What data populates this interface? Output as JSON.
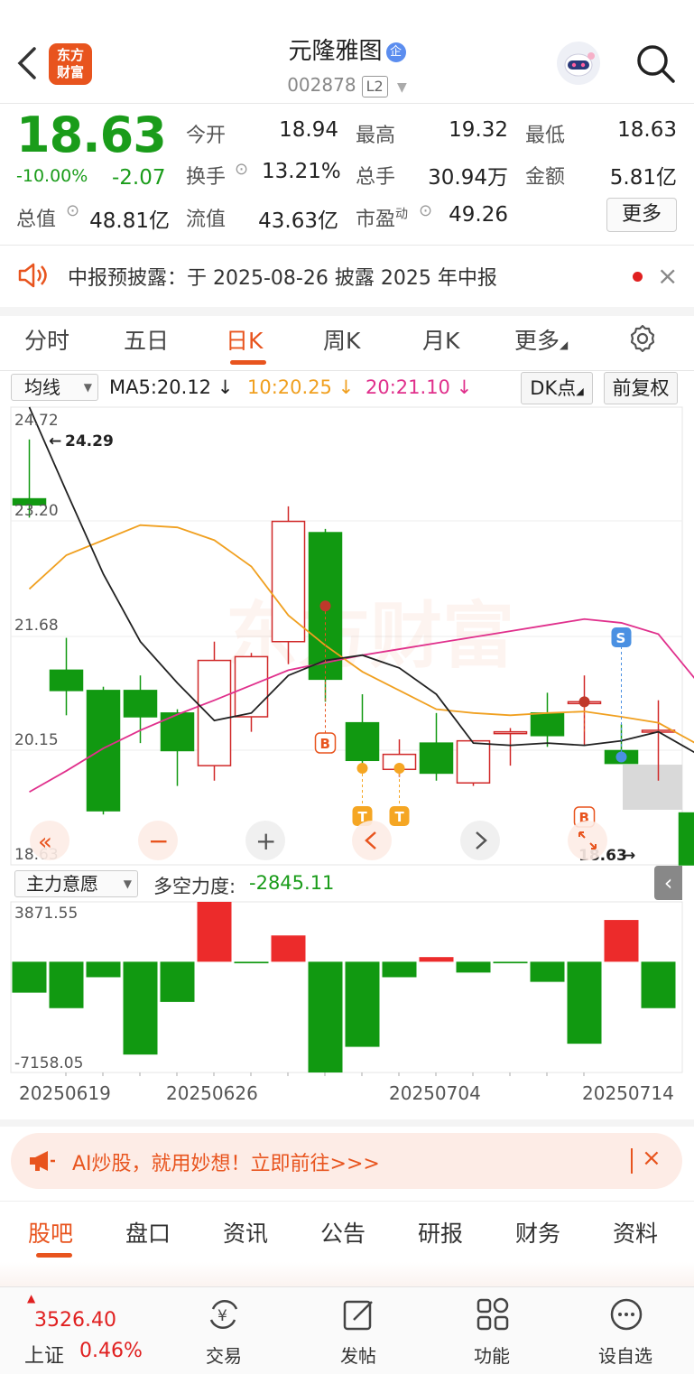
{
  "header": {
    "logo_line1": "东方",
    "logo_line2": "财富",
    "title": "元隆雅图",
    "title_badge": "企",
    "code": "002878",
    "level_badge": "L2"
  },
  "quote": {
    "price": "18.63",
    "change_pct": "-10.00%",
    "change": "-2.07",
    "items": [
      {
        "label": "今开",
        "value": "18.94"
      },
      {
        "label": "最高",
        "value": "19.32"
      },
      {
        "label": "最低",
        "value": "18.63"
      },
      {
        "label": "换手",
        "value": "13.21%"
      },
      {
        "label": "总手",
        "value": "30.94万"
      },
      {
        "label": "金额",
        "value": "5.81亿"
      },
      {
        "label": "总值",
        "value": "48.81亿"
      },
      {
        "label": "流值",
        "value": "43.63亿"
      },
      {
        "label": "市盈",
        "value": "49.26"
      }
    ],
    "pe_sup": "动",
    "more_label": "更多"
  },
  "notice": {
    "text": "中报预披露：于 2025-08-26 披露 2025 年中报",
    "close": "×"
  },
  "kline_tabs": [
    "分时",
    "五日",
    "日K",
    "周K",
    "月K",
    "更多"
  ],
  "ma_bar": {
    "selector": "均线",
    "ma5": "MA5:20.12",
    "ma10": "10:20.25",
    "ma20": "20:21.10",
    "dk_label": "DK点",
    "fq_label": "前复权",
    "colors": {
      "ma5": "#222222",
      "ma10": "#f0a020",
      "ma20": "#e0308c"
    }
  },
  "chart_data": {
    "type": "candlestick",
    "y_ticks": [
      "24.72",
      "23.20",
      "21.68",
      "20.15",
      "18.63"
    ],
    "ylim": [
      18.63,
      24.72
    ],
    "high_marker": "24.29",
    "last_marker": "18.63",
    "dates": [
      "20250619",
      "20250626",
      "20250704",
      "20250714"
    ],
    "candles": [
      {
        "o": 23.5,
        "h": 24.29,
        "l": 23.25,
        "c": 23.42
      },
      {
        "o": 21.22,
        "h": 21.65,
        "l": 20.62,
        "c": 20.95
      },
      {
        "o": 20.95,
        "h": 21.0,
        "l": 19.3,
        "c": 19.35
      },
      {
        "o": 20.95,
        "h": 21.15,
        "l": 20.25,
        "c": 20.6
      },
      {
        "o": 20.65,
        "h": 20.7,
        "l": 19.68,
        "c": 20.15
      },
      {
        "o": 19.95,
        "h": 21.6,
        "l": 19.75,
        "c": 21.35
      },
      {
        "o": 20.6,
        "h": 21.45,
        "l": 20.4,
        "c": 21.4
      },
      {
        "o": 21.6,
        "h": 23.4,
        "l": 21.3,
        "c": 23.2
      },
      {
        "o": 23.05,
        "h": 23.1,
        "l": 20.8,
        "c": 21.1
      },
      {
        "o": 20.52,
        "h": 20.9,
        "l": 19.85,
        "c": 20.02
      },
      {
        "o": 19.9,
        "h": 20.3,
        "l": 19.8,
        "c": 20.1
      },
      {
        "o": 20.25,
        "h": 20.65,
        "l": 19.75,
        "c": 19.85
      },
      {
        "o": 19.72,
        "h": 20.28,
        "l": 19.68,
        "c": 20.28
      },
      {
        "o": 20.4,
        "h": 20.45,
        "l": 19.95,
        "c": 20.4
      },
      {
        "o": 20.65,
        "h": 20.92,
        "l": 20.2,
        "c": 20.35
      },
      {
        "o": 20.8,
        "h": 21.15,
        "l": 20.22,
        "c": 20.8
      },
      {
        "o": 20.15,
        "h": 20.5,
        "l": 20.0,
        "c": 19.98
      },
      {
        "o": 20.42,
        "h": 20.82,
        "l": 19.75,
        "c": 20.42
      },
      {
        "o": 19.32,
        "h": 19.32,
        "l": 18.63,
        "c": 18.63
      }
    ],
    "ma5": [
      24.72,
      23.6,
      22.5,
      21.6,
      21.05,
      20.55,
      20.65,
      21.15,
      21.35,
      21.42,
      21.25,
      20.9,
      20.25,
      20.22,
      20.25,
      20.22,
      20.28,
      20.4,
      20.12
    ],
    "ma10": [
      22.3,
      22.75,
      22.95,
      23.15,
      23.12,
      22.95,
      22.6,
      21.95,
      21.55,
      21.2,
      20.95,
      20.7,
      20.65,
      20.62,
      20.65,
      20.67,
      20.6,
      20.52,
      20.25
    ],
    "ma20": [
      19.6,
      19.88,
      20.18,
      20.42,
      20.63,
      20.82,
      21.02,
      21.22,
      21.32,
      21.42,
      21.5,
      21.58,
      21.66,
      21.74,
      21.82,
      21.9,
      21.85,
      21.7,
      21.1
    ],
    "signals": [
      {
        "i": 8,
        "type": "B"
      },
      {
        "i": 9,
        "type": "T"
      },
      {
        "i": 10,
        "type": "T"
      },
      {
        "i": 15,
        "type": "B"
      },
      {
        "i": 16,
        "type": "S"
      }
    ]
  },
  "sub_chart": {
    "selector": "主力意愿",
    "label": "多空力度:",
    "value": "-2845.11",
    "max": "3871.55",
    "min": "-7158.05",
    "values": [
      -2000,
      -3000,
      -1000,
      -6000,
      -2600,
      3871.55,
      -100,
      1700,
      -7158.05,
      -5500,
      -1000,
      300,
      -700,
      -100,
      -1300,
      -5300,
      2700,
      -3000
    ]
  },
  "chart_controls": {
    "zoom_out": "−",
    "zoom_in": "+"
  },
  "ai_banner": {
    "text": "AI炒股，就用妙想！立即前往>>>",
    "close": "×"
  },
  "bottom_tabs": [
    "股吧",
    "盘口",
    "资讯",
    "公告",
    "研报",
    "财务",
    "资料"
  ],
  "bottom_nav": {
    "index_value": "3526.40",
    "index_name": "上证",
    "index_pct": "0.46%",
    "items": [
      "交易",
      "发帖",
      "功能",
      "设自选"
    ]
  }
}
